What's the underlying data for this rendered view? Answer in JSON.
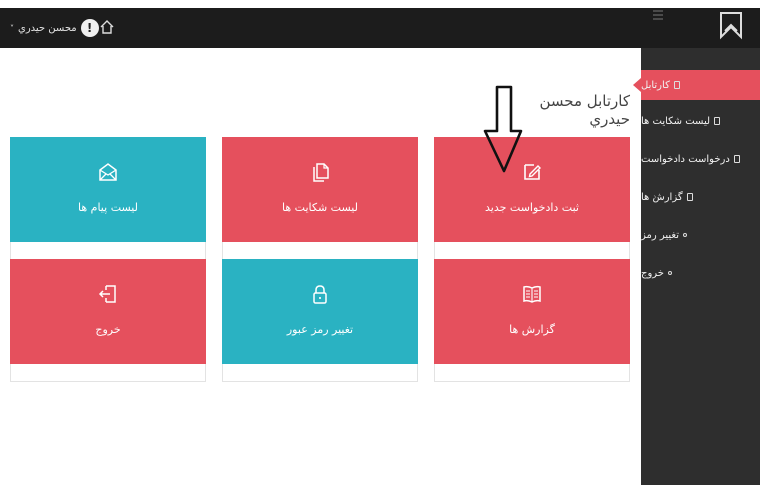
{
  "topbar": {
    "user_name": "محسن حيدري",
    "user_caret": "˅",
    "avatar_glyph": "!",
    "home_icon": "home-icon",
    "menu_icon": "hamburger-icon",
    "brand_icon": "logo-icon",
    "background": "#1c1c1c"
  },
  "sidebar": {
    "background": "#2e2e2e",
    "items": [
      {
        "label": "کارتابل",
        "active": true
      },
      {
        "label": "لیست شکایت ها"
      },
      {
        "label": "درخواست دادخواست"
      },
      {
        "label": "گزارش ها",
        "chevron": "‹"
      },
      {
        "label": "تغییر رمز"
      },
      {
        "label": "خروج"
      }
    ]
  },
  "main": {
    "page_title": "کارتابل محسن حيدري",
    "tiles": [
      {
        "label": "ثبت دادخواست جدید",
        "icon": "edit-icon",
        "color": "#e5505d"
      },
      {
        "label": "لیست شکایت ها",
        "icon": "documents-icon",
        "color": "#e5505d"
      },
      {
        "label": "لیست پیام ها",
        "icon": "mail-icon",
        "color": "#2ab2c2"
      },
      {
        "label": "گزارش ها",
        "icon": "book-icon",
        "color": "#e5505d"
      },
      {
        "label": "تغییر رمز عبور",
        "icon": "lock-icon",
        "color": "#2ab2c2"
      },
      {
        "label": "خروج",
        "icon": "exit-icon",
        "color": "#e5505d"
      }
    ]
  },
  "annotation": {
    "icon": "down-arrow-annotation"
  },
  "colors": {
    "accent_red": "#e5505d",
    "accent_teal": "#2ab2c2"
  }
}
